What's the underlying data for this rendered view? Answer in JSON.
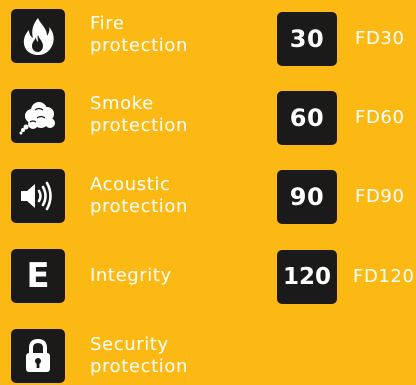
{
  "left": {
    "fire": {
      "label_line1": "Fire",
      "label_line2": "protection",
      "icon": "flame-icon"
    },
    "smoke": {
      "label_line1": "Smoke",
      "label_line2": "protection",
      "icon": "smoke-cloud-icon"
    },
    "acoustic": {
      "label_line1": "Acoustic",
      "label_line2": "protection",
      "icon": "speaker-icon"
    },
    "integrity": {
      "letter": "E",
      "label": "Integrity"
    },
    "security": {
      "label_line1": "Security",
      "label_line2": "protection",
      "icon": "padlock-icon"
    }
  },
  "right": [
    {
      "number": "30",
      "label": "FD30"
    },
    {
      "number": "60",
      "label": "FD60"
    },
    {
      "number": "90",
      "label": "FD90"
    },
    {
      "number": "120",
      "label": "FD120"
    }
  ],
  "colors": {
    "background": "#fdb913",
    "tile": "#1a1a1a",
    "text": "#ffffff"
  }
}
